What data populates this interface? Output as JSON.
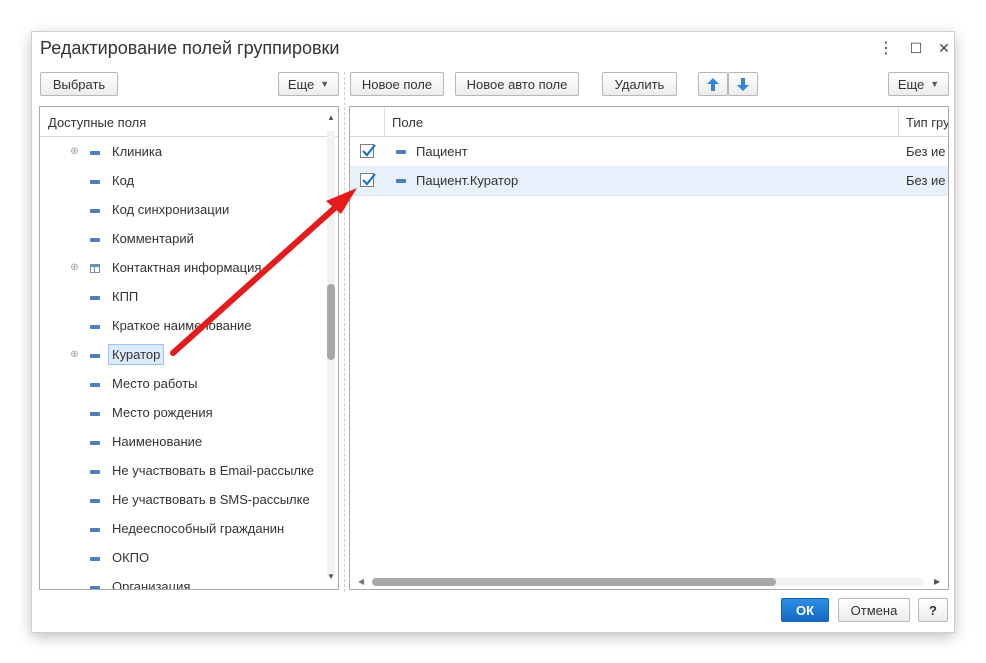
{
  "dialog": {
    "title": "Редактирование полей группировки"
  },
  "window_controls": {
    "more_glyph": "⋮",
    "maximize_glyph": "☐",
    "close_glyph": "✕"
  },
  "left_toolbar": {
    "select_label": "Выбрать",
    "more_label": "Еще"
  },
  "right_toolbar": {
    "new_field_label": "Новое поле",
    "new_auto_field_label": "Новое авто поле",
    "delete_label": "Удалить",
    "more_label": "Еще",
    "up_icon": "arrow-up-icon",
    "down_icon": "arrow-down-icon"
  },
  "available_fields": {
    "header": "Доступные поля",
    "items": [
      {
        "label": "Клиника",
        "expandable": true,
        "icon": "field-icon"
      },
      {
        "label": "Код",
        "expandable": false,
        "icon": "field-icon"
      },
      {
        "label": "Код синхронизации",
        "expandable": false,
        "icon": "field-icon"
      },
      {
        "label": "Комментарий",
        "expandable": false,
        "icon": "field-icon"
      },
      {
        "label": "Контактная информация",
        "expandable": true,
        "icon": "table-icon"
      },
      {
        "label": "КПП",
        "expandable": false,
        "icon": "field-icon"
      },
      {
        "label": "Краткое наименование",
        "expandable": false,
        "icon": "field-icon"
      },
      {
        "label": "Куратор",
        "expandable": true,
        "icon": "field-icon",
        "selected": true
      },
      {
        "label": "Место работы",
        "expandable": false,
        "icon": "field-icon"
      },
      {
        "label": "Место рождения",
        "expandable": false,
        "icon": "field-icon"
      },
      {
        "label": "Наименование",
        "expandable": false,
        "icon": "field-icon"
      },
      {
        "label": "Не участвовать в Email-рассылке",
        "expandable": false,
        "icon": "field-icon"
      },
      {
        "label": "Не участвовать в SMS-рассылке",
        "expandable": false,
        "icon": "field-icon"
      },
      {
        "label": "Недееспособный гражданин",
        "expandable": false,
        "icon": "field-icon"
      },
      {
        "label": "ОКПО",
        "expandable": false,
        "icon": "field-icon"
      },
      {
        "label": "Организация",
        "expandable": false,
        "icon": "field-icon"
      }
    ]
  },
  "grouping_fields": {
    "columns": {
      "field": "Поле",
      "type": "Тип гру"
    },
    "rows": [
      {
        "checked": true,
        "field": "Пациент",
        "type": "Без ие"
      },
      {
        "checked": true,
        "field": "Пациент.Куратор",
        "type": "Без ие",
        "selected": true
      }
    ]
  },
  "footer": {
    "ok_label": "ОК",
    "cancel_label": "Отмена",
    "help_label": "?"
  },
  "colors": {
    "annotation_arrow": "#e41b1b",
    "accent": "#1a72d0",
    "selection": "#dcebfb"
  }
}
